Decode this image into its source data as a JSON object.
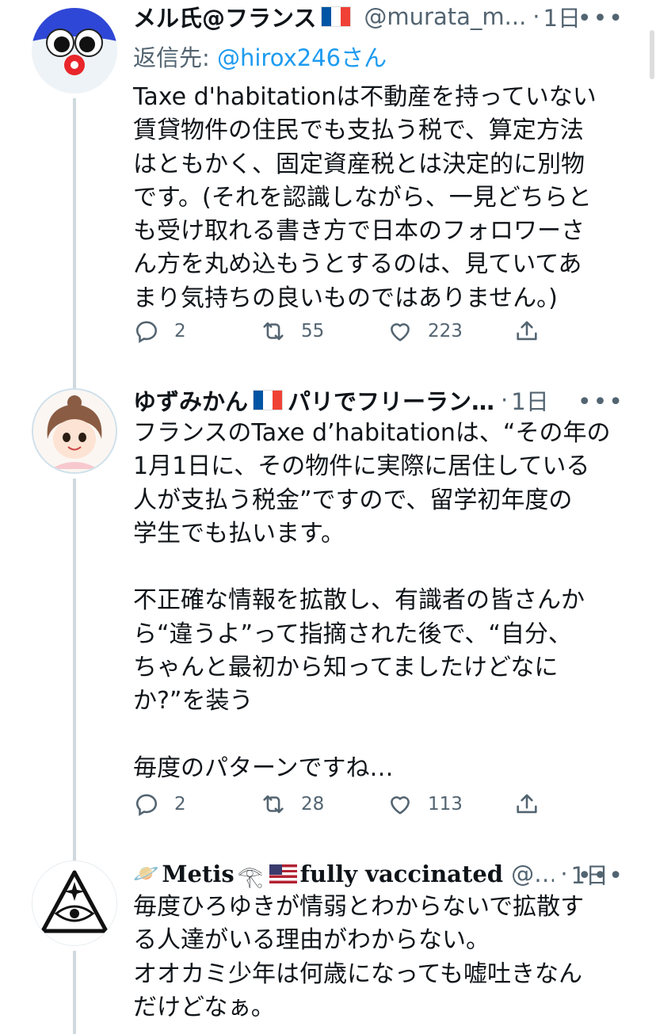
{
  "tweets": [
    {
      "name": "メル氏@フランス",
      "handle": "@murata_m...",
      "time": "1日",
      "reply_prefix": "返信先: ",
      "reply_to": "@hirox246さん",
      "text": "Taxe d'habitationは不動産を持っていない\n賃貸物件の住民でも支払う税で、算定方法\nはともかく、固定資産税とは決定的に別物\nです。(それを認識しながら、一見どちらと\nも受け取れる書き方で日本のフォロワーさ\nん方を丸め込もうとするのは、見ていてあ\nまり気持ちの良いものではありません。)",
      "replies": "2",
      "retweets": "55",
      "likes": "223"
    },
    {
      "name": "ゆずみかん",
      "name_suffix": "パリでフリーラン…",
      "time": "1日",
      "text": "フランスのTaxe d’habitationは、“その年の\n1月1日に、その物件に実際に居住している\n人が支払う税金”ですので、留学初年度の\n学生でも払います。\n\n不正確な情報を拡散し、有識者の皆さんか\nら“違うよ”って指摘された後で、“自分、\nちゃんと最初から知ってましたけどなに\nか?”を装う\n\n毎度のパターンですね…",
      "replies": "2",
      "retweets": "28",
      "likes": "113"
    },
    {
      "name": "Metis",
      "name_suffix": "fully vaccinated",
      "handle": "@...",
      "time": "1日",
      "text": "毎度ひろゆきが情弱とわからないで拡散す\nる人達がいる理由がわからない。\nオオカミ少年は何歳になっても嘘吐きなん\nだけどなぁ。"
    }
  ],
  "dot": "·",
  "more_icon": "•••",
  "colors": {
    "link": "#1d9bf0",
    "muted": "#536471",
    "line": "#cfd9de"
  }
}
